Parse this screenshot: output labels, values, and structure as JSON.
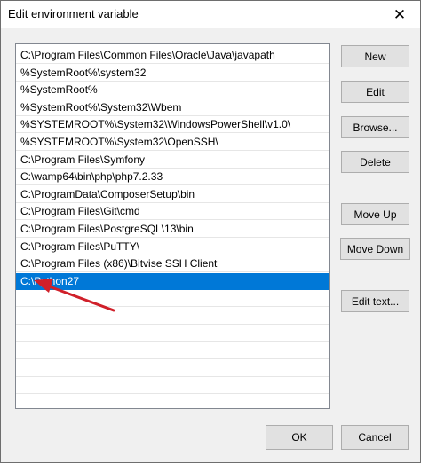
{
  "window": {
    "title": "Edit environment variable",
    "close_glyph": "✕"
  },
  "list": {
    "items": [
      "C:\\Program Files\\Common Files\\Oracle\\Java\\javapath",
      "%SystemRoot%\\system32",
      "%SystemRoot%",
      "%SystemRoot%\\System32\\Wbem",
      "%SYSTEMROOT%\\System32\\WindowsPowerShell\\v1.0\\",
      "%SYSTEMROOT%\\System32\\OpenSSH\\",
      "C:\\Program Files\\Symfony",
      "C:\\wamp64\\bin\\php\\php7.2.33",
      "C:\\ProgramData\\ComposerSetup\\bin",
      "C:\\Program Files\\Git\\cmd",
      "C:\\Program Files\\PostgreSQL\\13\\bin",
      "C:\\Program Files\\PuTTY\\",
      "C:\\Program Files (x86)\\Bitvise SSH Client",
      "C:\\Python27"
    ],
    "selected_index": 13
  },
  "buttons": {
    "new": "New",
    "edit": "Edit",
    "browse": "Browse...",
    "delete": "Delete",
    "move_up": "Move Up",
    "move_down": "Move Down",
    "edit_text": "Edit text...",
    "ok": "OK",
    "cancel": "Cancel"
  },
  "colors": {
    "selection": "#0078d7",
    "annotation_arrow": "#d0202a"
  }
}
